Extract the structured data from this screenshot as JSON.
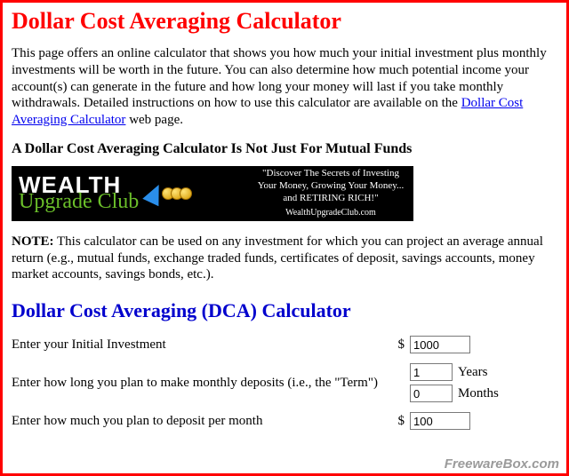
{
  "title": "Dollar Cost Averaging Calculator",
  "intro_part1": "This page offers an online calculator that shows you how much your initial investment plus monthly investments will be worth in the future. You can also determine how much potential income your account(s) can generate in the future and how long your money will last if you take monthly withdrawals. Detailed instructions on how to use this calculator are available on the ",
  "intro_link": "Dollar Cost Averaging Calculator",
  "intro_part2": " web page.",
  "subheading": "A Dollar Cost Averaging Calculator Is Not Just For Mutual Funds",
  "banner": {
    "brand_top": "WEALTH",
    "brand_bottom": "Upgrade Club",
    "tagline": "\"Discover The Secrets of Investing Your Money, Growing Your Money... and RETIRING RICH!\"",
    "site": "WealthUpgradeClub.com"
  },
  "note_label": "NOTE:",
  "note_body": "  This calculator can be used on any investment for which you can project an average annual return (e.g., mutual funds, exchange traded funds, certificates of deposit, savings accounts, money market accounts, savings bonds, etc.).",
  "section_heading": "Dollar Cost Averaging (DCA) Calculator",
  "form": {
    "row1_label": "Enter your Initial Investment",
    "row1_currency": "$",
    "row1_value": "1000",
    "row2_label": "Enter how long you plan to make monthly deposits (i.e., the \"Term\")",
    "row2_years_value": "1",
    "row2_years_unit": "Years",
    "row2_months_value": "0",
    "row2_months_unit": "Months",
    "row3_label": "Enter how much you plan to deposit per month",
    "row3_currency": "$",
    "row3_value": "100"
  },
  "watermark": "FreewareBox.com"
}
